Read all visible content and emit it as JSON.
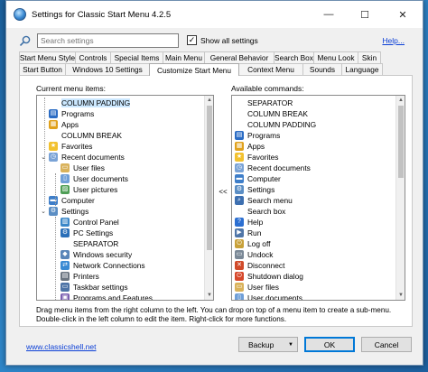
{
  "window": {
    "title": "Settings for Classic Start Menu 4.2.5",
    "minimize_glyph": "—",
    "maximize_glyph": "☐",
    "close_glyph": "✕"
  },
  "search": {
    "placeholder": "Search settings",
    "show_all_label": "Show all settings",
    "show_all_checked": "✓",
    "help_label": "Help..."
  },
  "tabs": {
    "row1": [
      "Start Menu Style",
      "Controls",
      "Special Items",
      "Main Menu",
      "General Behavior",
      "Search Box",
      "Menu Look",
      "Skin"
    ],
    "row2": [
      "Start Button",
      "Windows 10 Settings",
      "Customize Start Menu",
      "Context Menu",
      "Sounds",
      "Language"
    ],
    "active": "Customize Start Menu"
  },
  "current_items": {
    "label": "Current menu items:",
    "items": [
      {
        "text": "COLUMN PADDING",
        "icon": "none",
        "indent": 1,
        "selected": true
      },
      {
        "text": "Programs",
        "icon": "programs-icon",
        "indent": 1
      },
      {
        "text": "Apps",
        "icon": "apps-icon",
        "indent": 1
      },
      {
        "text": "COLUMN BREAK",
        "icon": "none",
        "indent": 1
      },
      {
        "text": "Favorites",
        "icon": "favorites-icon",
        "indent": 1
      },
      {
        "text": "Recent documents",
        "icon": "recent-documents-icon",
        "indent": 1,
        "expander": "⌄"
      },
      {
        "text": "User files",
        "icon": "user-files-icon",
        "indent": 2
      },
      {
        "text": "User documents",
        "icon": "user-documents-icon",
        "indent": 2
      },
      {
        "text": "User pictures",
        "icon": "user-pictures-icon",
        "indent": 2
      },
      {
        "text": "Computer",
        "icon": "computer-icon",
        "indent": 1
      },
      {
        "text": "Settings",
        "icon": "settings-icon",
        "indent": 1,
        "expander": "⌄"
      },
      {
        "text": "Control Panel",
        "icon": "control-panel-icon",
        "indent": 2
      },
      {
        "text": "PC Settings",
        "icon": "pc-settings-icon",
        "indent": 2
      },
      {
        "text": "SEPARATOR",
        "icon": "none",
        "indent": 2
      },
      {
        "text": "Windows security",
        "icon": "windows-security-icon",
        "indent": 2
      },
      {
        "text": "Network Connections",
        "icon": "network-connections-icon",
        "indent": 2
      },
      {
        "text": "Printers",
        "icon": "printers-icon",
        "indent": 2
      },
      {
        "text": "Taskbar settings",
        "icon": "taskbar-settings-icon",
        "indent": 2
      },
      {
        "text": "Programs and Features",
        "icon": "programs-features-icon",
        "indent": 2
      }
    ]
  },
  "available_commands": {
    "label": "Available commands:",
    "items": [
      {
        "text": "SEPARATOR",
        "icon": "none"
      },
      {
        "text": "COLUMN BREAK",
        "icon": "none"
      },
      {
        "text": "COLUMN PADDING",
        "icon": "none"
      },
      {
        "text": "Programs",
        "icon": "programs-icon"
      },
      {
        "text": "Apps",
        "icon": "apps-icon"
      },
      {
        "text": "Favorites",
        "icon": "favorites-icon"
      },
      {
        "text": "Recent documents",
        "icon": "recent-documents-icon"
      },
      {
        "text": "Computer",
        "icon": "computer-icon"
      },
      {
        "text": "Settings",
        "icon": "settings-icon"
      },
      {
        "text": "Search menu",
        "icon": "search-menu-icon"
      },
      {
        "text": "Search box",
        "icon": "none"
      },
      {
        "text": "Help",
        "icon": "help-icon"
      },
      {
        "text": "Run",
        "icon": "run-icon"
      },
      {
        "text": "Log off",
        "icon": "log-off-icon"
      },
      {
        "text": "Undock",
        "icon": "undock-icon"
      },
      {
        "text": "Disconnect",
        "icon": "disconnect-icon"
      },
      {
        "text": "Shutdown dialog",
        "icon": "shutdown-dialog-icon"
      },
      {
        "text": "User files",
        "icon": "user-files-icon"
      },
      {
        "text": "User documents",
        "icon": "user-documents-icon"
      }
    ]
  },
  "move_label": "<<",
  "hint": {
    "line1": "Drag menu items from the right column to the left. You can drop on top of a menu item to create a sub-menu.",
    "line2": "Double-click in the left column to edit the item. Right-click for more functions."
  },
  "footer": {
    "link": "www.classicshell.net",
    "backup_label": "Backup",
    "backup_arrow": "▼",
    "ok_label": "OK",
    "cancel_label": "Cancel"
  },
  "colors": {
    "selection": "#cce8ff",
    "link": "#0b3fd6",
    "accent": "#0078d7"
  }
}
